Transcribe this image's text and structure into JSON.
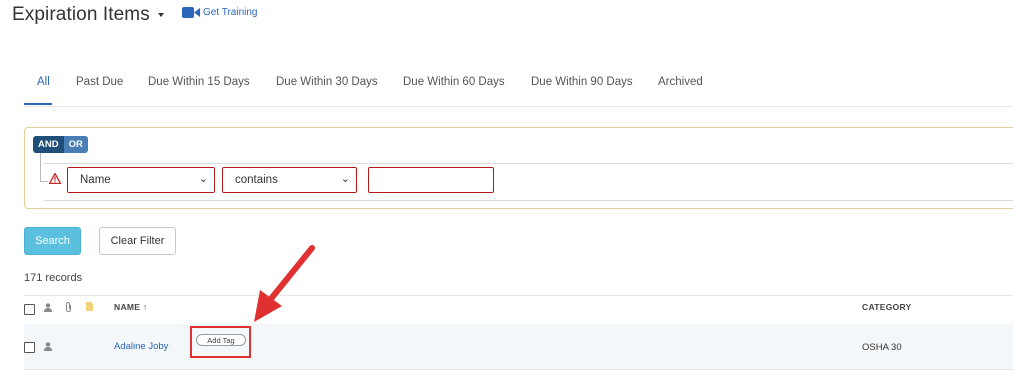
{
  "header": {
    "title": "Expiration Items",
    "training_link": "Get Training"
  },
  "tabs": [
    {
      "label": "All",
      "active": true
    },
    {
      "label": "Past Due"
    },
    {
      "label": "Due Within 15 Days"
    },
    {
      "label": "Due Within 30 Days"
    },
    {
      "label": "Due Within 60 Days"
    },
    {
      "label": "Due Within 90 Days"
    },
    {
      "label": "Archived"
    }
  ],
  "filter": {
    "and_label": "AND",
    "or_label": "OR",
    "field_value": "Name",
    "operator_value": "contains",
    "input_value": ""
  },
  "actions": {
    "search_label": "Search",
    "clear_label": "Clear Filter"
  },
  "records_count": "171 records",
  "table": {
    "headers": {
      "name": "NAME ↑",
      "category": "CATEGORY"
    },
    "rows": [
      {
        "name": "Adaline Joby",
        "tag_button": "Add Tag",
        "category": "OSHA 30"
      }
    ]
  },
  "colors": {
    "accent": "#2a67b8",
    "search_button": "#5bc0de",
    "error_border": "#b31b1b",
    "annotation": "#e03030"
  }
}
